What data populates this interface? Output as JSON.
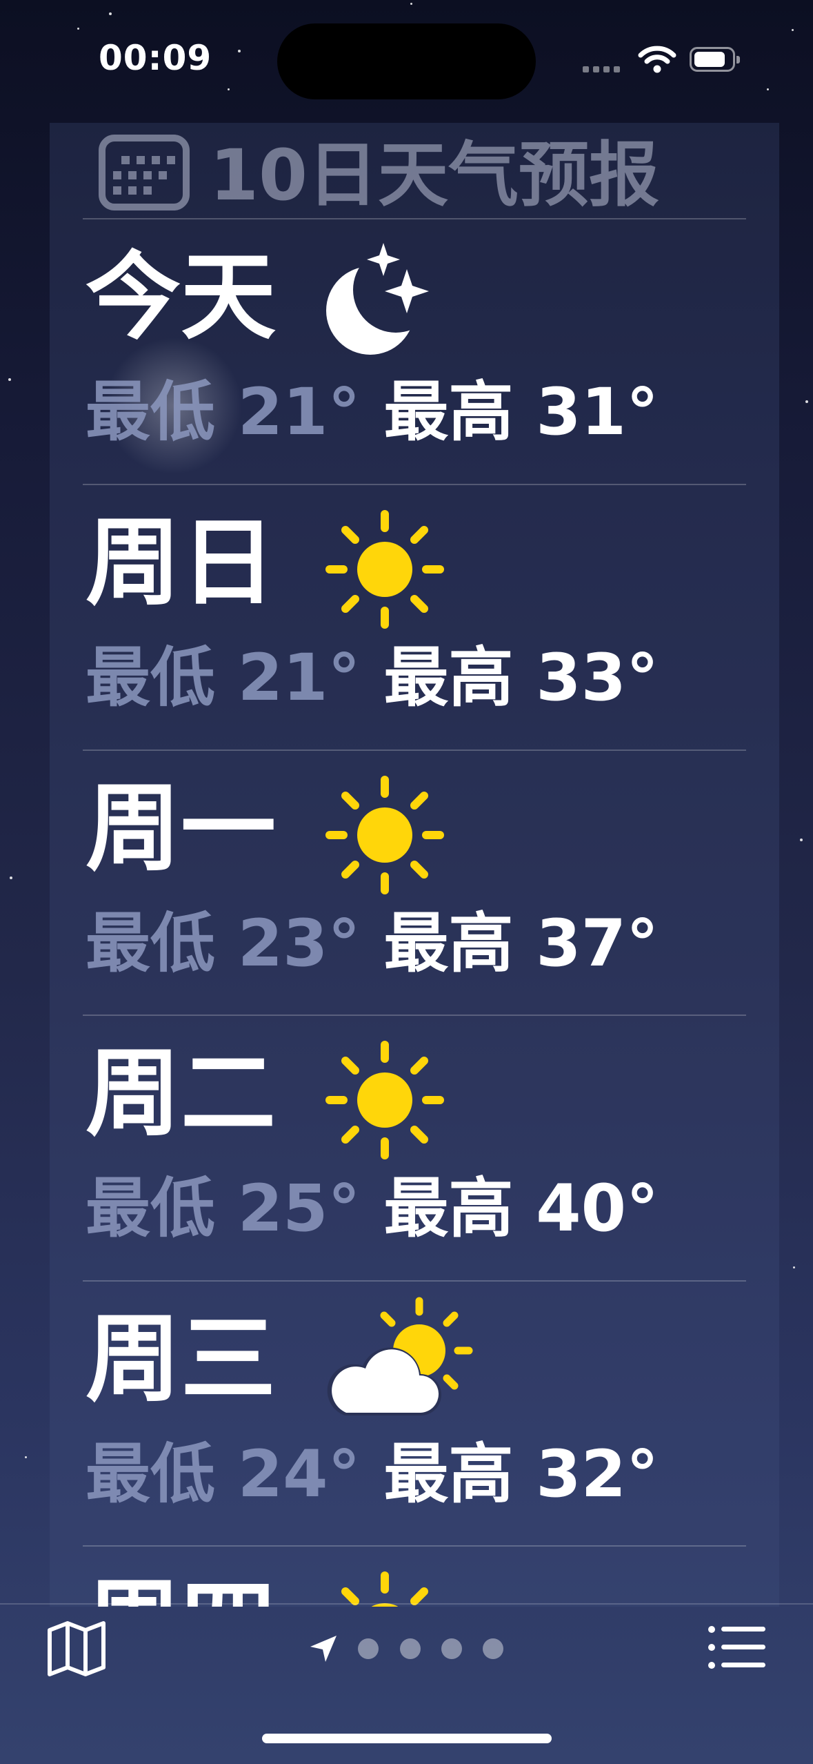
{
  "status_bar": {
    "time": "00:09"
  },
  "forecast": {
    "title": "10日天气预报",
    "days": [
      {
        "day": "今天",
        "icon": "moon-stars-icon",
        "low": "最低 21°",
        "high": "最高 31°"
      },
      {
        "day": "周日",
        "icon": "sun-icon",
        "low": "最低 21°",
        "high": "最高 33°"
      },
      {
        "day": "周一",
        "icon": "sun-icon",
        "low": "最低 23°",
        "high": "最高 37°"
      },
      {
        "day": "周二",
        "icon": "sun-icon",
        "low": "最低 25°",
        "high": "最高 40°"
      },
      {
        "day": "周三",
        "icon": "partly-cloudy-icon",
        "low": "最低 24°",
        "high": "最高 32°"
      },
      {
        "day": "周四",
        "icon": "sun-icon"
      }
    ]
  },
  "toolbar": {
    "map_icon": "map-icon",
    "location_icon": "location-arrow-icon",
    "page_dots": 4,
    "list_icon": "list-icon"
  },
  "colors": {
    "sun": "#FFD60A",
    "low_temp": "#8C98BE",
    "background_top": "#0C0F22",
    "background_bottom": "#34426E"
  }
}
